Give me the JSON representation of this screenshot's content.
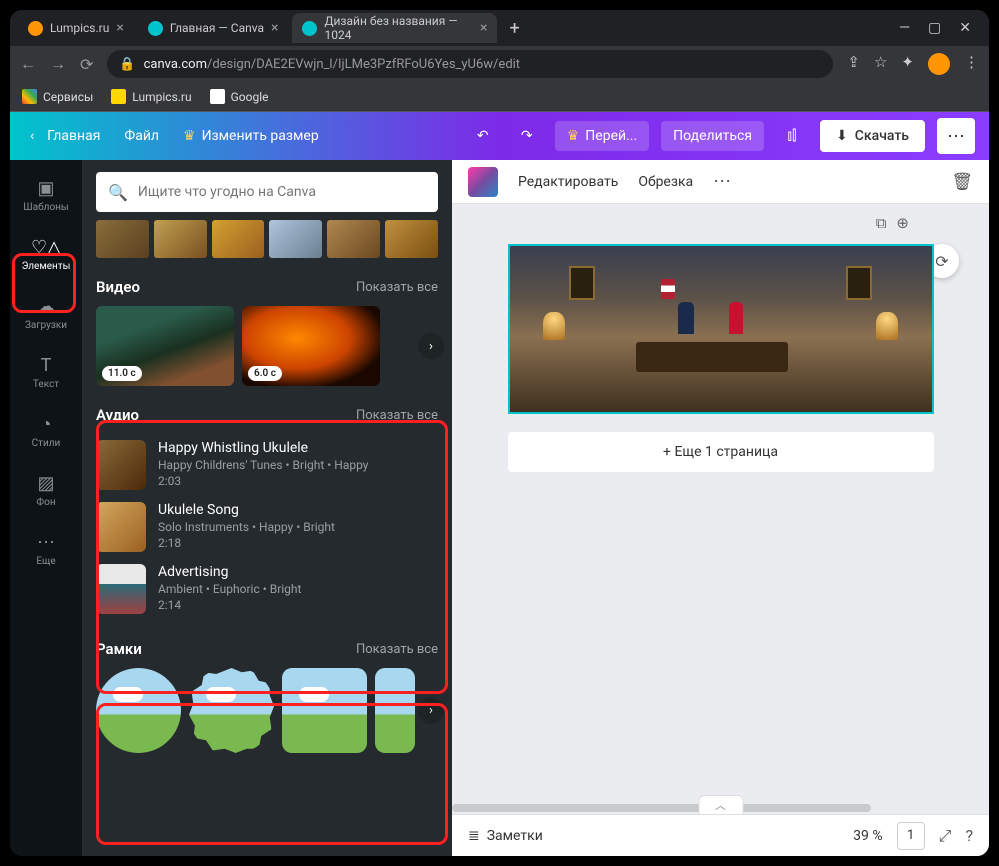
{
  "browser": {
    "tabs": [
      {
        "title": "Lumpics.ru",
        "active": false
      },
      {
        "title": "Главная — Canva",
        "active": false
      },
      {
        "title": "Дизайн без названия — 1024",
        "active": true
      }
    ],
    "url_host": "canva.com",
    "url_path": "/design/DAE2EVwjn_l/IjLMe3PzfRFoU6Yes_yU6w/edit",
    "bookmarks": [
      {
        "label": "Сервисы"
      },
      {
        "label": "Lumpics.ru"
      },
      {
        "label": "Google"
      }
    ]
  },
  "topbar": {
    "home": "Главная",
    "file": "Файл",
    "resize": "Изменить размер",
    "upgrade": "Перей...",
    "share": "Поделиться",
    "download": "Скачать"
  },
  "rail": {
    "items": [
      {
        "key": "templates",
        "label": "Шаблоны",
        "icon": "▣"
      },
      {
        "key": "elements",
        "label": "Элементы",
        "icon": "♡△"
      },
      {
        "key": "uploads",
        "label": "Загрузки",
        "icon": "☁"
      },
      {
        "key": "text",
        "label": "Текст",
        "icon": "T"
      },
      {
        "key": "styles",
        "label": "Стили",
        "icon": "◔"
      },
      {
        "key": "background",
        "label": "Фон",
        "icon": "▨"
      },
      {
        "key": "more",
        "label": "Еще",
        "icon": "⋯"
      }
    ],
    "active": "elements"
  },
  "panel": {
    "search_placeholder": "Ищите что угодно на Canva",
    "video": {
      "title": "Видео",
      "show_all": "Показать все",
      "items": [
        {
          "duration": "11.0 c"
        },
        {
          "duration": "6.0 c"
        }
      ]
    },
    "audio": {
      "title": "Аудио",
      "show_all": "Показать все",
      "items": [
        {
          "title": "Happy Whistling Ukulele",
          "meta": "Happy Childrens' Tunes • Bright • Happy",
          "duration": "2:03"
        },
        {
          "title": "Ukulele Song",
          "meta": "Solo Instruments • Happy • Bright",
          "duration": "2:18"
        },
        {
          "title": "Advertising",
          "meta": "Ambient • Euphoric • Bright",
          "duration": "2:14"
        }
      ]
    },
    "frames": {
      "title": "Рамки",
      "show_all": "Показать все"
    }
  },
  "context": {
    "edit": "Редактировать",
    "crop": "Обрезка"
  },
  "canvas": {
    "add_page": "+ Еще 1 страница"
  },
  "bottombar": {
    "notes": "Заметки",
    "zoom": "39 %",
    "pages": "1"
  }
}
